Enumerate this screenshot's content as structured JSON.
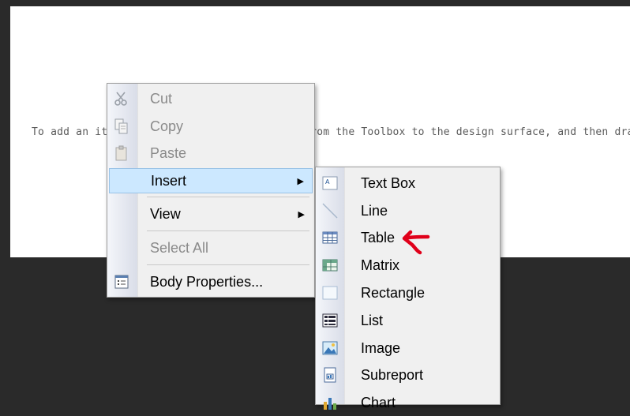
{
  "design_surface": {
    "hint_text": "To add an item to the report, drag an item from the Toolbox to the design surface, and then drag"
  },
  "context_menu": {
    "items": [
      {
        "label": "Cut",
        "icon": "scissors-icon",
        "enabled": false
      },
      {
        "label": "Copy",
        "icon": "copy-icon",
        "enabled": false
      },
      {
        "label": "Paste",
        "icon": "clipboard-icon",
        "enabled": false
      },
      {
        "label": "Insert",
        "submenu": true,
        "highlighted": true
      },
      {
        "label": "View",
        "submenu": true
      },
      {
        "label": "Select All",
        "enabled": false
      },
      {
        "label": "Body Properties...",
        "icon": "properties-icon"
      }
    ],
    "submenu_arrow": "▶"
  },
  "insert_submenu": {
    "items": [
      {
        "label": "Text Box",
        "icon": "textbox-icon"
      },
      {
        "label": "Line",
        "icon": "line-icon"
      },
      {
        "label": "Table",
        "icon": "table-icon"
      },
      {
        "label": "Matrix",
        "icon": "matrix-icon"
      },
      {
        "label": "Rectangle",
        "icon": "rectangle-icon"
      },
      {
        "label": "List",
        "icon": "list-icon"
      },
      {
        "label": "Image",
        "icon": "image-icon"
      },
      {
        "label": "Subreport",
        "icon": "subreport-icon"
      },
      {
        "label": "Chart",
        "icon": "chart-icon"
      }
    ]
  },
  "colors": {
    "annotation_arrow": "#e0001a",
    "highlight": "#cce8ff"
  }
}
